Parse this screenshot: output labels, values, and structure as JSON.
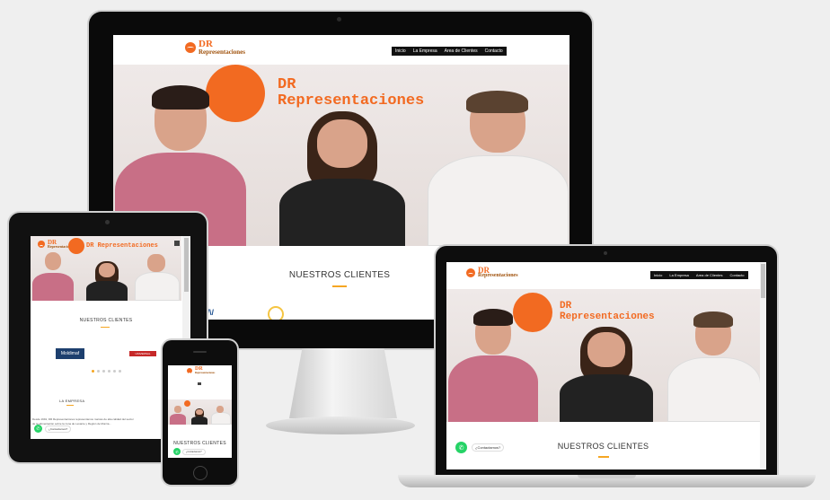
{
  "site": {
    "logo_top": "DR",
    "logo_bottom": "Representaciones",
    "nav": [
      "Inicio",
      "La Empresa",
      "Area de Clientes",
      "Contacto"
    ],
    "wall_line1": "DR",
    "wall_line2": "Representaciones",
    "section_clients": "NUESTROS CLIENTES",
    "section_company": "LA EMPRESA",
    "client_logo_1": "Moldimaf",
    "client_logo_2": "UNIVERSAL",
    "company_text": "Desde 1991, DR Representaciones representamos marcas de alta calidad del sector de la alimentación sobre la zona de Levante y Región de Murcia...",
    "contact_pill": "¿Contactamos?",
    "accent_color": "#f26a21",
    "whatsapp_color": "#25d366"
  }
}
